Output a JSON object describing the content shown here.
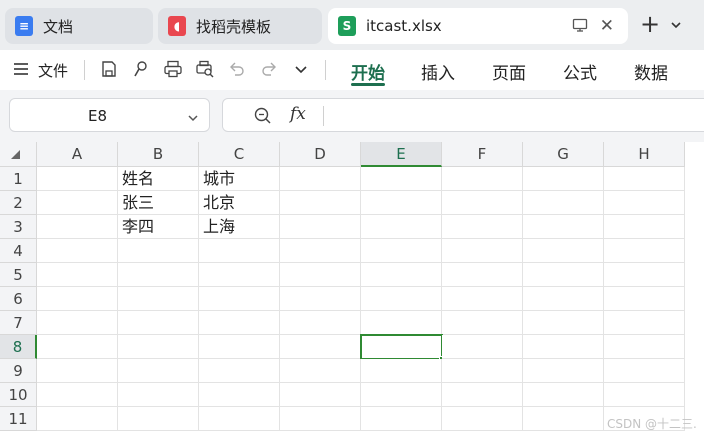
{
  "tabs": [
    {
      "label": "文档",
      "icon": "doc-app-icon",
      "color": "#3a7cf0",
      "glyph": "≡",
      "active": false
    },
    {
      "label": "找稻壳模板",
      "icon": "docer-template-icon",
      "color": "#e9474f",
      "glyph": "◖",
      "active": false
    },
    {
      "label": "itcast.xlsx",
      "icon": "spreadsheet-app-icon",
      "color": "#1e9e5a",
      "glyph": "S",
      "active": true
    }
  ],
  "toolbar": {
    "file_menu": "文件",
    "ribbon_tabs": [
      "开始",
      "插入",
      "页面",
      "公式",
      "数据"
    ],
    "active_ribbon_tab": "开始"
  },
  "formula_bar": {
    "name_box": "E8",
    "fx_label": "fx",
    "formula_value": ""
  },
  "sheet": {
    "columns": [
      "A",
      "B",
      "C",
      "D",
      "E",
      "F",
      "G",
      "H"
    ],
    "rows": [
      "1",
      "2",
      "3",
      "4",
      "5",
      "6",
      "7",
      "8",
      "9",
      "10",
      "11"
    ],
    "selected_cell": "E8",
    "data": [
      [
        "",
        "姓名",
        "城市",
        "",
        "",
        "",
        "",
        ""
      ],
      [
        "",
        "张三",
        "北京",
        "",
        "",
        "",
        "",
        ""
      ],
      [
        "",
        "李四",
        "上海",
        "",
        "",
        "",
        "",
        ""
      ],
      [
        "",
        "",
        "",
        "",
        "",
        "",
        "",
        ""
      ],
      [
        "",
        "",
        "",
        "",
        "",
        "",
        "",
        ""
      ],
      [
        "",
        "",
        "",
        "",
        "",
        "",
        "",
        ""
      ],
      [
        "",
        "",
        "",
        "",
        "",
        "",
        "",
        ""
      ],
      [
        "",
        "",
        "",
        "",
        "",
        "",
        "",
        ""
      ],
      [
        "",
        "",
        "",
        "",
        "",
        "",
        "",
        ""
      ],
      [
        "",
        "",
        "",
        "",
        "",
        "",
        "",
        ""
      ],
      [
        "",
        "",
        "",
        "",
        "",
        "",
        "",
        ""
      ]
    ]
  },
  "watermark": "CSDN @十二三."
}
